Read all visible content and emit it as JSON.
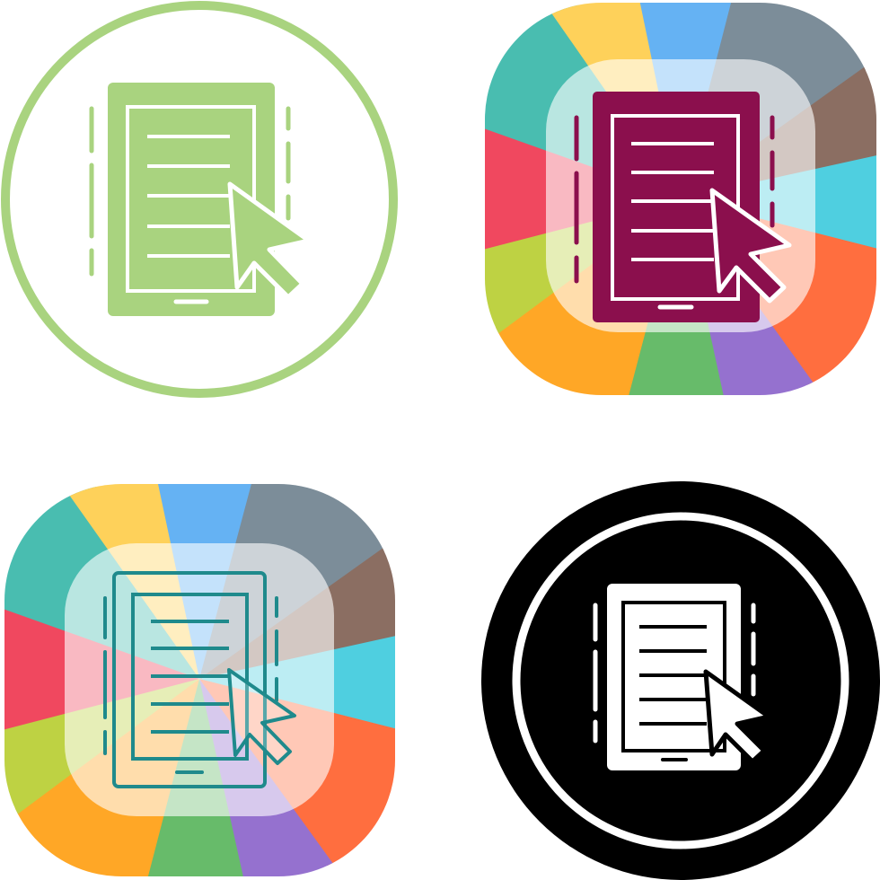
{
  "icons": [
    {
      "name": "ebook-reader-icon",
      "style": "flat-circle-outline",
      "primary": "#a9d37f",
      "ring": "#a9d37f",
      "inner": "#ffffff"
    },
    {
      "name": "ebook-reader-icon",
      "style": "glyph-rainbow-squircle",
      "primary": "#8b0f4d",
      "inner": "#ffffff"
    },
    {
      "name": "ebook-reader-icon",
      "style": "line-rainbow-squircle",
      "primary": "#1f8a8c"
    },
    {
      "name": "ebook-reader-icon",
      "style": "glyph-black-circle",
      "primary": "#ffffff",
      "background": "#000000",
      "inner": "#000000"
    }
  ],
  "palette": {
    "rainbow": [
      "#f0485f",
      "#49bdb0",
      "#fed15a",
      "#65b2f3",
      "#7c8d99",
      "#8b6e62",
      "#4fcfe0",
      "#ff6e3f",
      "#9571cf",
      "#67bb6a",
      "#ffa726",
      "#bed243"
    ]
  }
}
